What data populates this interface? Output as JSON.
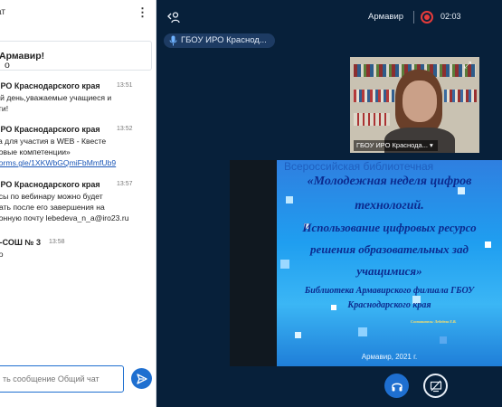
{
  "chat": {
    "header_title": "ат",
    "welcome_prefix": "о ",
    "welcome_bold": "Армавир!",
    "messages": [
      {
        "author": "ИРО Краснодарского края",
        "time": "13:51",
        "lines": [
          "ый день,уважаемые учащиеся и",
          "оги!"
        ]
      },
      {
        "author": "ИРО Краснодарского края",
        "time": "13:52",
        "lines": [
          "ка для участия в WEB - Квесте",
          "ровые компетенции»"
        ],
        "link": "/forms.gle/1XKWbGQmiFbMmfUb9"
      },
      {
        "author": "ИРО Краснодарского края",
        "time": "13:57",
        "lines": [
          "осы по вебинару можно будет",
          "лать после его завершения на",
          "ронную почту lebedeva_n_a@iro23.ru"
        ]
      },
      {
        "author": "У-СОШ № 3",
        "time": "13:58",
        "lines": [
          "но"
        ]
      }
    ],
    "composer_placeholder": "ть сообщение Общий чат"
  },
  "conference": {
    "presenter_name": "Армавир",
    "record_time": "02:03",
    "talking_badge": "ГБОУ ИРО Краснод...",
    "webcam_label": "ГБОУ ИРО Краснода... ▾"
  },
  "slide": {
    "head": "Всероссийская библиотечная",
    "lines": [
      "«Молодежная неделя цифров",
      "технологий.",
      "Использование цифровых ресурсо",
      "решения образовательных зад",
      "учащимися»"
    ],
    "sublines": [
      "Библиотека Армавирского филиала ГБОУ",
      "Краснодарского края"
    ],
    "stamp": "Составитель: Лебедева Е.В.",
    "footer": "Армавир, 2021 г."
  },
  "colors": {
    "accent": "#1e6fd0",
    "stage_bg": "#07203a",
    "record": "#e53b3b"
  },
  "icons": [
    "kebab-menu-icon",
    "send-icon",
    "users-icon",
    "microphone-icon",
    "record-icon",
    "fullscreen-icon",
    "headphones-icon",
    "screen-share-off-icon"
  ]
}
